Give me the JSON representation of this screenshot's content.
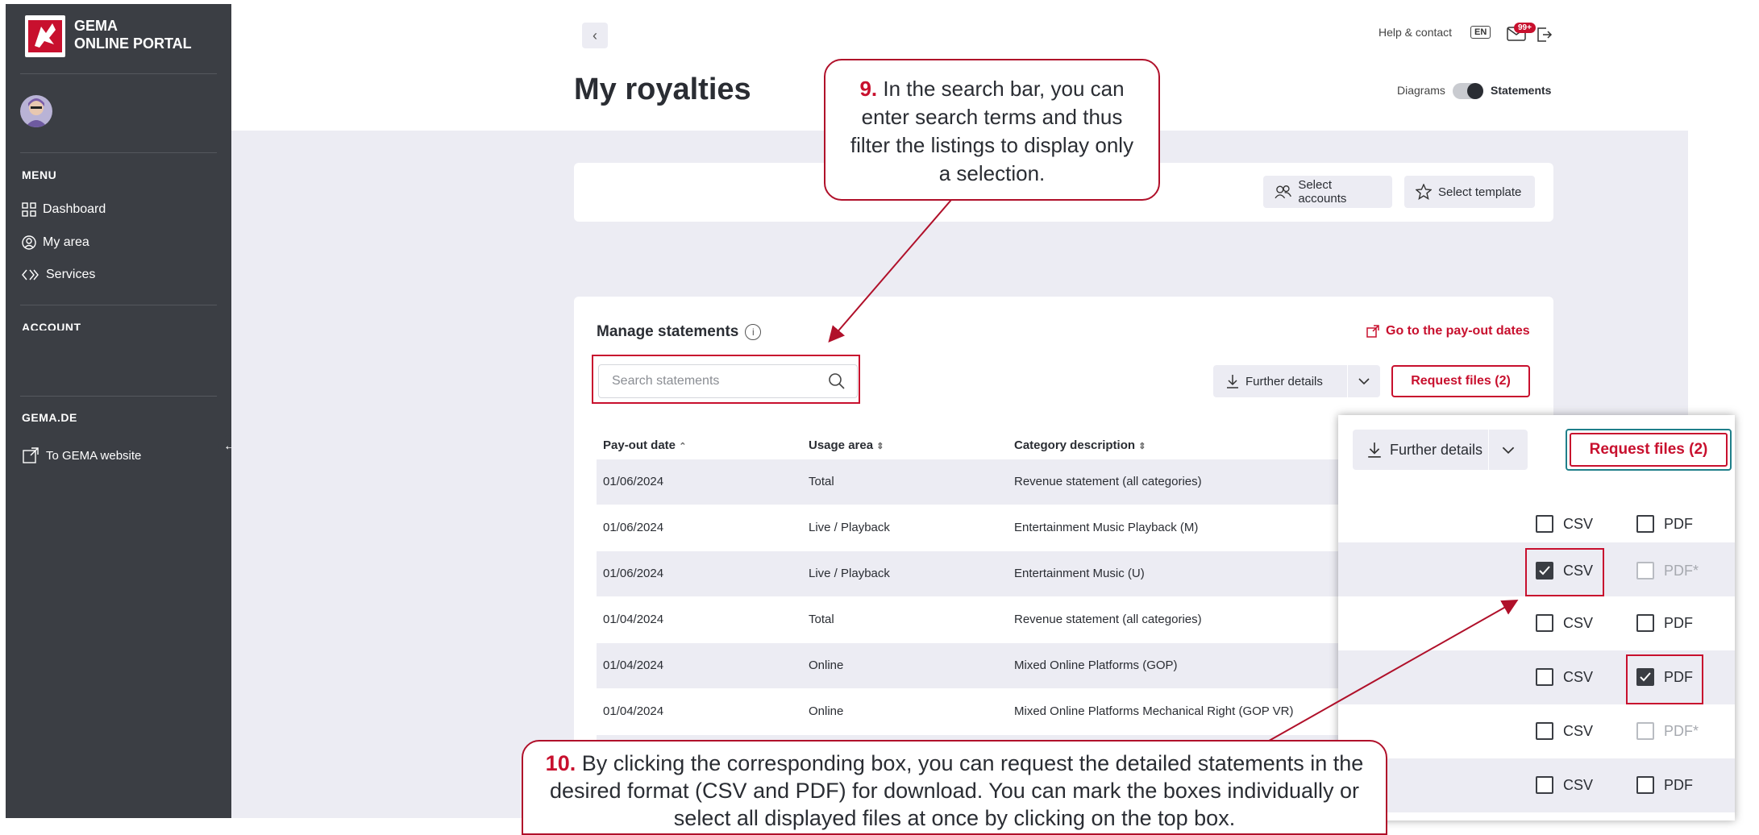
{
  "sidebar": {
    "logo_line1": "GEMA",
    "logo_line2": "ONLINE PORTAL",
    "menu_heading": "MENU",
    "items": [
      {
        "label": "Dashboard",
        "icon": "grid-icon"
      },
      {
        "label": "My area",
        "icon": "user-circle-icon"
      },
      {
        "label": "Services",
        "icon": "chevrons-icon"
      }
    ],
    "account_heading": "ACCOUNT",
    "gema_heading": "GEMA.DE",
    "website_link": "To GEMA website"
  },
  "header": {
    "back_icon": "chevron-left-icon",
    "title": "My royalties",
    "help_label": "Help & contact",
    "lang": "EN",
    "notification_badge": "99+",
    "toggle_left": "Diagrams",
    "toggle_right": "Statements",
    "toggle_state": "Statements"
  },
  "filters": {
    "select_accounts": "Select accounts",
    "select_template": "Select template"
  },
  "statements": {
    "title": "Manage statements",
    "info_icon": "i",
    "payout_link": "Go to the pay-out dates",
    "search_placeholder": "Search statements",
    "further_details": "Further details",
    "request_files": "Request files (2)",
    "columns": [
      "Pay-out date",
      "Usage area",
      "Category description"
    ],
    "rows": [
      {
        "date": "01/06/2024",
        "area": "Total",
        "category": "Revenue statement (all categories)"
      },
      {
        "date": "01/06/2024",
        "area": "Live / Playback",
        "category": "Entertainment Music Playback (M)"
      },
      {
        "date": "01/06/2024",
        "area": "Live / Playback",
        "category": "Entertainment Music (U)"
      },
      {
        "date": "01/04/2024",
        "area": "Total",
        "category": "Revenue statement (all categories)"
      },
      {
        "date": "01/04/2024",
        "area": "Online",
        "category": "Mixed Online Platforms (GOP)"
      },
      {
        "date": "01/04/2024",
        "area": "Online",
        "category": "Mixed Online Platforms Mechanical Right (GOP VR)"
      }
    ]
  },
  "zoom": {
    "further_details": "Further details",
    "request_files": "Request files (2)",
    "rows": [
      {
        "csv": "CSV",
        "csv_checked": false,
        "pdf": "PDF",
        "pdf_checked": false,
        "pdf_disabled": false
      },
      {
        "csv": "CSV",
        "csv_checked": true,
        "pdf": "PDF*",
        "pdf_checked": false,
        "pdf_disabled": true
      },
      {
        "csv": "CSV",
        "csv_checked": false,
        "pdf": "PDF",
        "pdf_checked": false,
        "pdf_disabled": false
      },
      {
        "csv": "CSV",
        "csv_checked": false,
        "pdf": "PDF",
        "pdf_checked": true,
        "pdf_disabled": false
      },
      {
        "csv": "CSV",
        "csv_checked": false,
        "pdf": "PDF*",
        "pdf_checked": false,
        "pdf_disabled": true
      },
      {
        "csv": "CSV",
        "csv_checked": false,
        "pdf": "PDF",
        "pdf_checked": false,
        "pdf_disabled": false
      }
    ]
  },
  "callouts": {
    "c9_num": "9.",
    "c9_text": "In the search bar, you can enter search terms and thus filter the listings to display only a selection.",
    "c10_num": "10.",
    "c10_text": "By clicking the corresponding box, you can request the detailed statements in the desired format (CSV and PDF) for download. You can mark the boxes individually or select all displayed files at once by clicking on the top box."
  },
  "colors": {
    "accent": "#c8102e",
    "sidebar": "#3b3e44",
    "page_bg": "#ececf3"
  }
}
